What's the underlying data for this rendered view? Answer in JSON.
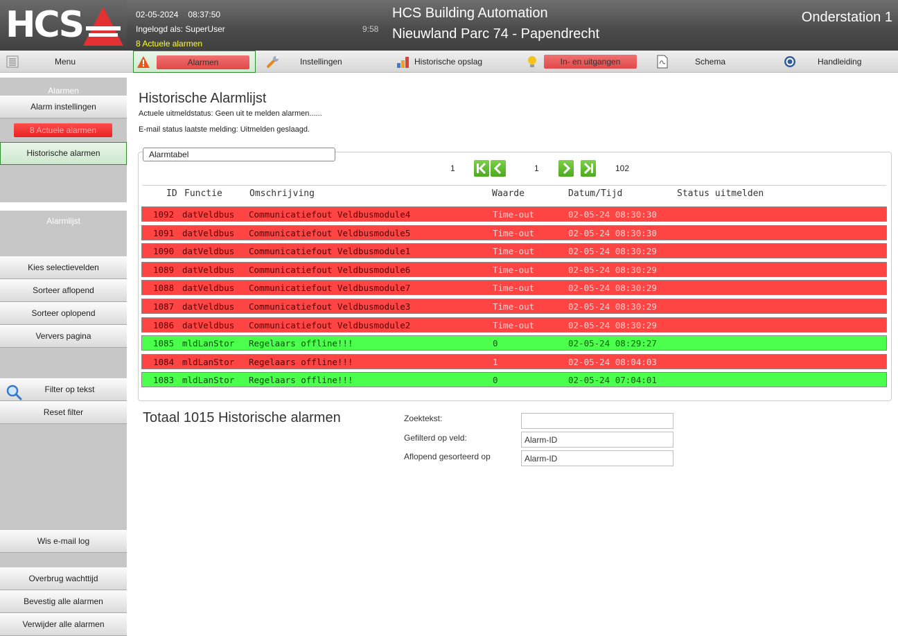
{
  "header": {
    "logo_text": "HCS",
    "date": "02-05-2024",
    "time": "08:37:50",
    "logged_in": "Ingelogd als: SuperUser",
    "elapsed": "9:58",
    "active_alarms": "8 Actuele alarmen",
    "app_title": "HCS Building Automation",
    "site_title": "Nieuwland Parc 74 - Papendrecht",
    "station": "Onderstation 1"
  },
  "nav": {
    "menu": "Menu",
    "alarmen": "Alarmen",
    "instellingen": "Instellingen",
    "historische_opslag": "Historische opslag",
    "in_uitgangen": "In- en uitgangen",
    "schema": "Schema",
    "handleiding": "Handleiding"
  },
  "sidebar": {
    "section_alarmen": "Alarmen",
    "alarm_instellingen": "Alarm instellingen",
    "actuele_alarmen": "8 Actuele alarmen",
    "historische_alarmen": "Historische alarmen",
    "section_alarmlijst": "Alarmlijst",
    "kies_selectievelden": "Kies selectievelden",
    "sorteer_aflopend": "Sorteer aflopend",
    "sorteer_oplopend": "Sorteer oplopend",
    "ververs_pagina": "Ververs pagina",
    "filter_op_tekst": "Filter op tekst",
    "reset_filter": "Reset filter",
    "wis_email_log": "Wis e-mail log",
    "overbrug_wachttijd": "Overbrug wachttijd",
    "bevestig_alle": "Bevestig alle alarmen",
    "verwijder_alle": "Verwijder alle alarmen"
  },
  "main": {
    "title": "Historische Alarmlijst",
    "status_uitmeld": "Actuele uitmeldstatus: Geen uit te melden alarmen......",
    "status_email": "E-mail status laatste melding: Uitmelden geslaagd.",
    "panel_legend": "Alarmtabel",
    "pager": {
      "first_page": "1",
      "current_page": "1",
      "last_page": "102"
    },
    "columns": {
      "id": "ID",
      "functie": "Functie",
      "omschrijving": "Omschrijving",
      "waarde": "Waarde",
      "datum": "Datum/Tijd",
      "status": "Status uitmelden"
    },
    "rows": [
      {
        "id": "1092",
        "functie": "datVeldbus",
        "omschrijving": "Communicatiefout Veldbusmodule4",
        "waarde": "Time-out",
        "datum": "02-05-24 08:30:30",
        "state": "red"
      },
      {
        "id": "1091",
        "functie": "datVeldbus",
        "omschrijving": "Communicatiefout Veldbusmodule5",
        "waarde": "Time-out",
        "datum": "02-05-24 08:30:30",
        "state": "red"
      },
      {
        "id": "1090",
        "functie": "datVeldbus",
        "omschrijving": "Communicatiefout Veldbusmodule1",
        "waarde": "Time-out",
        "datum": "02-05-24 08:30:29",
        "state": "red"
      },
      {
        "id": "1089",
        "functie": "datVeldbus",
        "omschrijving": "Communicatiefout Veldbusmodule6",
        "waarde": "Time-out",
        "datum": "02-05-24 08:30:29",
        "state": "red"
      },
      {
        "id": "1088",
        "functie": "datVeldbus",
        "omschrijving": "Communicatiefout Veldbusmodule7",
        "waarde": "Time-out",
        "datum": "02-05-24 08:30:29",
        "state": "red"
      },
      {
        "id": "1087",
        "functie": "datVeldbus",
        "omschrijving": "Communicatiefout Veldbusmodule3",
        "waarde": "Time-out",
        "datum": "02-05-24 08:30:29",
        "state": "red"
      },
      {
        "id": "1086",
        "functie": "datVeldbus",
        "omschrijving": "Communicatiefout Veldbusmodule2",
        "waarde": "Time-out",
        "datum": "02-05-24 08:30:29",
        "state": "red"
      },
      {
        "id": "1085",
        "functie": "mldLanStor",
        "omschrijving": "Regelaars offline!!!",
        "waarde": "0",
        "datum": "02-05-24 08:29:27",
        "state": "green"
      },
      {
        "id": "1084",
        "functie": "mldLanStor",
        "omschrijving": "Regelaars offline!!!",
        "waarde": "1",
        "datum": "02-05-24 08:04:03",
        "state": "red"
      },
      {
        "id": "1083",
        "functie": "mldLanStor",
        "omschrijving": "Regelaars offline!!!",
        "waarde": "0",
        "datum": "02-05-24 07:04:01",
        "state": "green"
      }
    ],
    "totaal": "Totaal 1015 Historische alarmen",
    "filter": {
      "zoektekst_label": "Zoektekst:",
      "zoektekst_value": "",
      "veld_label": "Gefilterd op veld:",
      "veld_value": "Alarm-ID",
      "sort_label": "Aflopend gesorteerd op",
      "sort_value": "Alarm-ID"
    }
  },
  "colors": {
    "alarm_red": "#ff4444",
    "ok_green": "#4cff4c",
    "header_alarm_yellow": "#ffff33",
    "logo_red": "#e33030"
  }
}
